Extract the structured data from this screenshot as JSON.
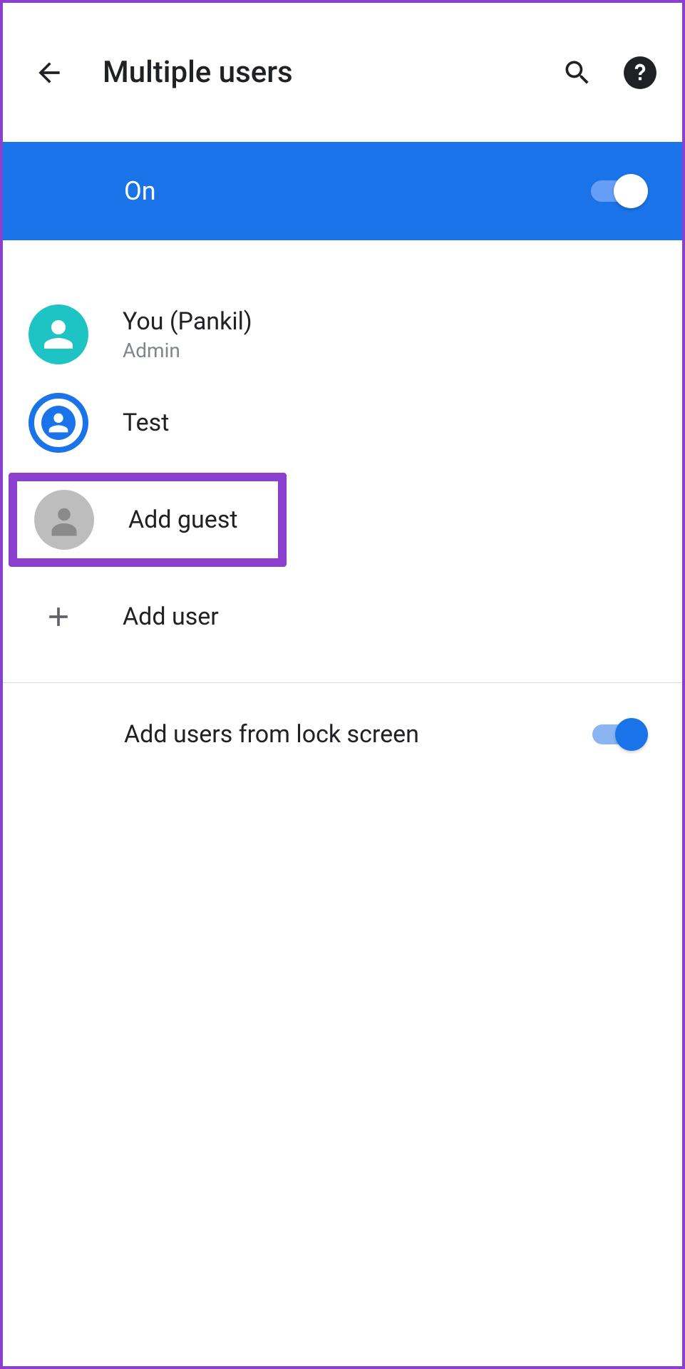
{
  "header": {
    "title": "Multiple users"
  },
  "banner": {
    "label": "On",
    "enabled": true
  },
  "users": [
    {
      "name": "You (Pankil)",
      "subtitle": "Admin",
      "avatar": "teal"
    },
    {
      "name": "Test",
      "subtitle": "",
      "avatar": "blue-ring"
    },
    {
      "name": "Add guest",
      "subtitle": "",
      "avatar": "gray",
      "highlighted": true
    }
  ],
  "actions": {
    "add_user": "Add user"
  },
  "settings": {
    "lock_screen_label": "Add users from lock screen",
    "lock_screen_enabled": true
  }
}
